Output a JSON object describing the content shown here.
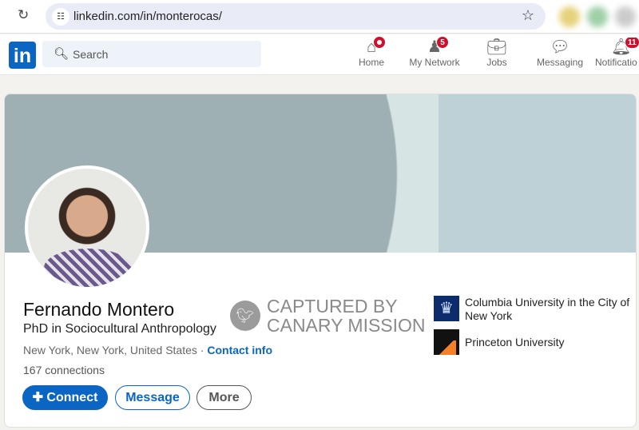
{
  "browser": {
    "url": "linkedin.com/in/monterocas/",
    "icons": [
      "reload-icon",
      "site-settings-icon",
      "bookmark-star-icon"
    ]
  },
  "nav": {
    "logo": "in",
    "search_placeholder": "Search",
    "items": [
      {
        "label": "Home",
        "icon": "home-icon",
        "badge": ""
      },
      {
        "label": "My Network",
        "icon": "network-icon",
        "badge": "5"
      },
      {
        "label": "Jobs",
        "icon": "briefcase-icon",
        "badge": ""
      },
      {
        "label": "Messaging",
        "icon": "chat-icon",
        "badge": ""
      },
      {
        "label": "Notificatio",
        "icon": "bell-icon",
        "badge": "11"
      }
    ]
  },
  "profile": {
    "name": "Fernando Montero",
    "headline": "PhD in Sociocultural Anthropology",
    "location": "New York, New York, United States",
    "separator": " · ",
    "contact_info": "Contact info",
    "connections": "167 connections",
    "buttons": {
      "connect": "Connect",
      "message": "Message",
      "more": "More"
    },
    "education": [
      {
        "name": "Columbia University in the City of New York",
        "logo_color": "#0c2c6b"
      },
      {
        "name": "Princeton University",
        "logo_color": "#f58025"
      }
    ]
  },
  "watermark": {
    "line1": "CAPTURED BY",
    "line2": "CANARY MISSION"
  },
  "colors": {
    "accent": "#0a66c2",
    "badge": "#cb112d"
  }
}
